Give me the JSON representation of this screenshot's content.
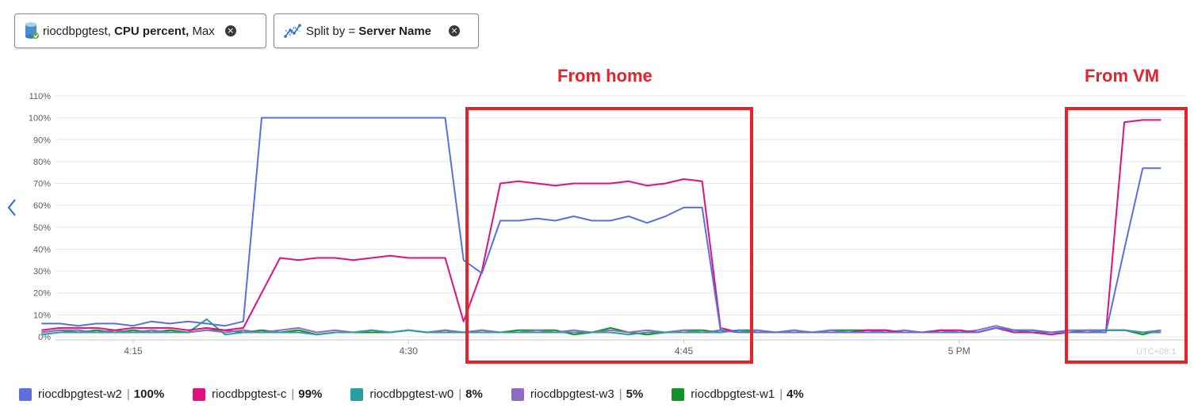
{
  "filters": [
    {
      "resource": "riocdbpgtest,",
      "metric": "CPU percent,",
      "aggregation": "Max"
    },
    {
      "label": "Split by =",
      "value": "Server Name"
    }
  ],
  "close_glyph": "×",
  "annotations": [
    "From home",
    "From VM"
  ],
  "timezone": "UTC+08:1",
  "colors": {
    "annotation": "#e8212a"
  },
  "chart_data": {
    "type": "line",
    "title": "",
    "xlabel": "",
    "ylabel": "",
    "x_range": [
      "4:10",
      "5:12"
    ],
    "ylim": [
      0,
      110
    ],
    "y_ticks": [
      "0%",
      "10%",
      "20%",
      "30%",
      "40%",
      "50%",
      "60%",
      "70%",
      "80%",
      "90%",
      "100%",
      "110%"
    ],
    "x_ticks": [
      "4:15",
      "4:30",
      "4:45",
      "5 PM"
    ],
    "x_tick_minutes": [
      15,
      30,
      45,
      60
    ],
    "grid": true,
    "legend_position": "bottom-left",
    "x_minutes": [
      10,
      11,
      12,
      13,
      14,
      15,
      16,
      17,
      18,
      19,
      20,
      21,
      22,
      23,
      24,
      25,
      26,
      27,
      28,
      29,
      30,
      31,
      32,
      33,
      34,
      35,
      36,
      37,
      38,
      39,
      40,
      41,
      42,
      43,
      44,
      45,
      46,
      47,
      48,
      49,
      50,
      51,
      52,
      53,
      54,
      55,
      56,
      57,
      58,
      59,
      60,
      61,
      62,
      63,
      64,
      65,
      66,
      67,
      68,
      69,
      70,
      71
    ],
    "series": [
      {
        "name": "riocdbpgtest-w2",
        "color": "#5b6fe0",
        "legend_value": "100%",
        "values": [
          6,
          6,
          5,
          6,
          6,
          5,
          7,
          6,
          7,
          6,
          5,
          7,
          100,
          100,
          100,
          100,
          100,
          100,
          100,
          100,
          100,
          100,
          100,
          35,
          29,
          53,
          53,
          54,
          53,
          55,
          53,
          53,
          55,
          52,
          55,
          59,
          59,
          3,
          2,
          2,
          2,
          2,
          2,
          2,
          2,
          2,
          2,
          2,
          2,
          2,
          2,
          2,
          4,
          3,
          3,
          2,
          2,
          2,
          2,
          40,
          77,
          77
        ]
      },
      {
        "name": "riocdbpgtest-c",
        "color": "#e0117f",
        "legend_value": "99%",
        "values": [
          3,
          4,
          4,
          4,
          3,
          4,
          4,
          4,
          3,
          4,
          3,
          4,
          20,
          36,
          35,
          36,
          36,
          35,
          36,
          37,
          36,
          36,
          36,
          7,
          30,
          70,
          71,
          70,
          69,
          70,
          70,
          70,
          71,
          69,
          70,
          72,
          71,
          4,
          2,
          2,
          2,
          2,
          2,
          2,
          2,
          3,
          3,
          2,
          2,
          3,
          3,
          2,
          4,
          2,
          2,
          1,
          2,
          2,
          2,
          98,
          99,
          99
        ]
      },
      {
        "name": "riocdbpgtest-w0",
        "color": "#2a9e9e",
        "legend_value": "8%",
        "values": [
          1,
          2,
          2,
          2,
          2,
          2,
          2,
          2,
          2,
          8,
          1,
          2,
          2,
          2,
          2,
          1,
          2,
          2,
          3,
          2,
          3,
          2,
          2,
          2,
          2,
          2,
          2,
          2,
          2,
          2,
          2,
          2,
          1,
          2,
          2,
          2,
          2,
          2,
          3,
          2,
          2,
          2,
          2,
          2,
          2,
          2,
          2,
          2,
          2,
          2,
          2,
          2,
          4,
          3,
          2,
          2,
          2,
          2,
          3,
          3,
          2,
          2
        ]
      },
      {
        "name": "riocdbpgtest-w3",
        "color": "#8e6cc4",
        "legend_value": "5%",
        "values": [
          2,
          3,
          3,
          2,
          3,
          2,
          3,
          2,
          2,
          3,
          2,
          3,
          2,
          3,
          4,
          2,
          3,
          2,
          3,
          2,
          3,
          2,
          3,
          2,
          3,
          2,
          2,
          3,
          2,
          3,
          2,
          3,
          2,
          3,
          2,
          3,
          2,
          3,
          2,
          3,
          2,
          3,
          2,
          3,
          2,
          3,
          2,
          3,
          2,
          3,
          2,
          3,
          5,
          3,
          3,
          2,
          3,
          3,
          3,
          3,
          2,
          3
        ]
      },
      {
        "name": "riocdbpgtest-w1",
        "color": "#14922a",
        "legend_value": "4%",
        "values": [
          2,
          3,
          2,
          3,
          2,
          3,
          2,
          3,
          2,
          3,
          3,
          2,
          3,
          2,
          3,
          1,
          2,
          2,
          2,
          2,
          3,
          2,
          3,
          2,
          3,
          2,
          3,
          3,
          3,
          1,
          2,
          4,
          2,
          1,
          2,
          3,
          3,
          2,
          3,
          3,
          2,
          3,
          2,
          3,
          3,
          3,
          3,
          2,
          2,
          3,
          2,
          2,
          4,
          2,
          2,
          2,
          2,
          3,
          3,
          3,
          1,
          3
        ]
      }
    ]
  }
}
